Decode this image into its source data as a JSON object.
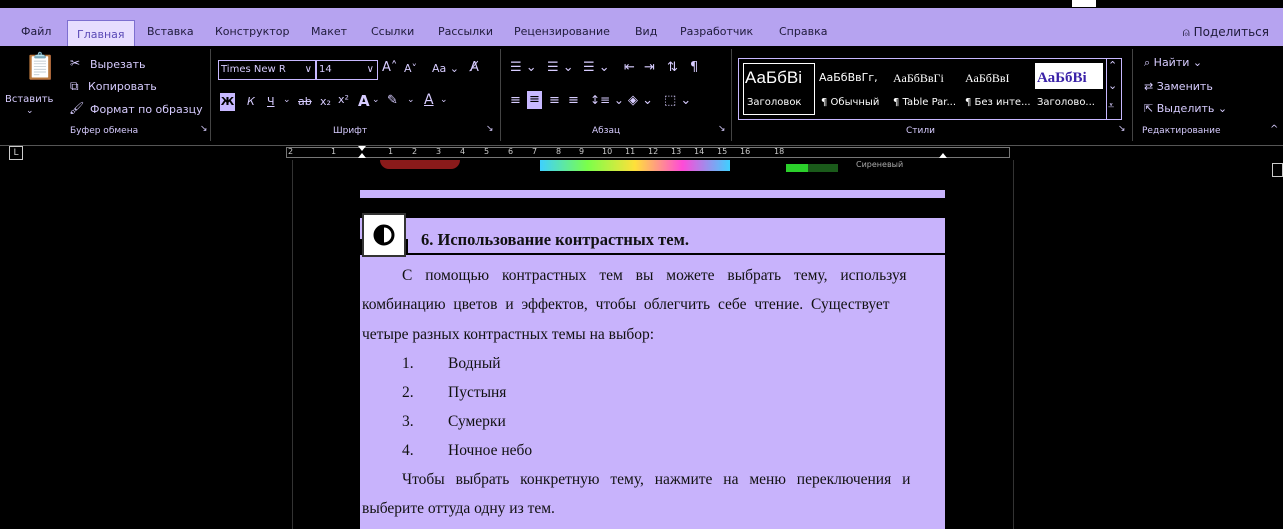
{
  "tabs": [
    "Файл",
    "Главная",
    "Вставка",
    "Конструктор",
    "Макет",
    "Ссылки",
    "Рассылки",
    "Рецензирование",
    "Вид",
    "Разработчик",
    "Справка"
  ],
  "share_label": "Поделиться",
  "clipboard": {
    "paste": "Вставить",
    "cut": "Вырезать",
    "copy": "Копировать",
    "format_painter": "Формат по образцу",
    "group": "Буфер обмена"
  },
  "font": {
    "name": "Times New R",
    "size": "14",
    "group": "Шрифт",
    "bold": "Ж",
    "italic": "К",
    "underline": "Ч"
  },
  "paragraph": {
    "group": "Абзац"
  },
  "styles": {
    "group": "Стили",
    "items": [
      {
        "sample": "АаБбВі",
        "name": "Заголовок"
      },
      {
        "sample": "АаБбВвГг,",
        "name": "¶ Обычный"
      },
      {
        "sample": "АаБбВвГі",
        "name": "¶ Table Par..."
      },
      {
        "sample": "АаБбВвІ",
        "name": "¶ Без инте..."
      },
      {
        "sample": "АаБбВі",
        "name": "Заголово..."
      }
    ]
  },
  "editing": {
    "find": "Найти",
    "replace": "Заменить",
    "select": "Выделить",
    "group": "Редактирование"
  },
  "ruler": [
    "2",
    "1",
    "1",
    "2",
    "3",
    "4",
    "5",
    "6",
    "7",
    "8",
    "9",
    "10",
    "11",
    "12",
    "13",
    "14",
    "15",
    "16",
    "18"
  ],
  "document": {
    "top_label": "Сиреневый",
    "heading": "6. Использование контрастных тем.",
    "p1_lines": [
      "С помощью контрастных тем вы можете выбрать тему, используя",
      "комбинацию цветов и эффектов, чтобы облегчить себе чтение. Существует",
      "четыре разных контрастных темы на выбор:"
    ],
    "list": [
      {
        "num": "1.",
        "text": "Водный"
      },
      {
        "num": "2.",
        "text": "Пустыня"
      },
      {
        "num": "3.",
        "text": "Сумерки"
      },
      {
        "num": "4.",
        "text": "Ночное небо"
      }
    ],
    "p2_lines": [
      "Чтобы выбрать конкретную тему, нажмите на меню переключения и",
      "выберите оттуда одну из тем."
    ]
  },
  "colors": {
    "accent": "#b6a3f0",
    "band": "#c8b3fc"
  }
}
